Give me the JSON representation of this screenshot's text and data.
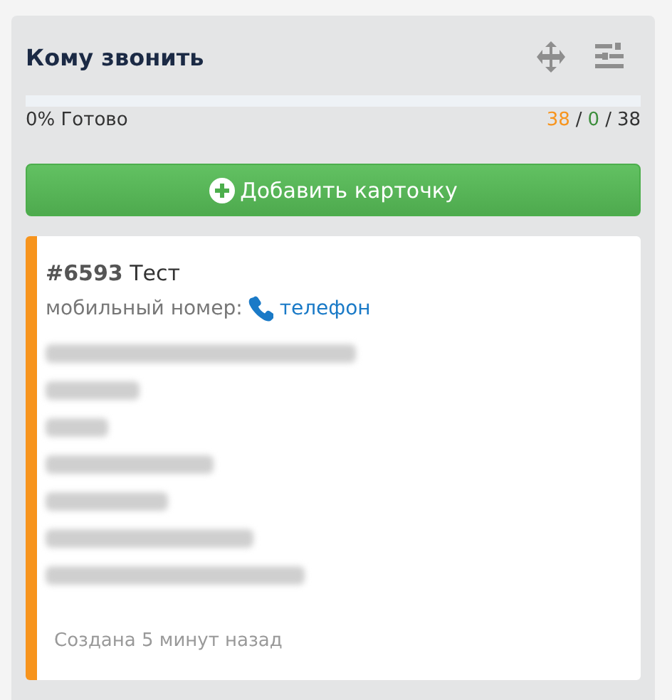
{
  "column": {
    "title": "Кому звонить",
    "progress": {
      "level": 0,
      "label": "0% Готово"
    },
    "counts": [
      {
        "kind": "value",
        "text": "38",
        "color": "#f7941d"
      },
      {
        "kind": "separator",
        "text": "/"
      },
      {
        "kind": "value",
        "text": "0",
        "color": "#3c8d3c"
      },
      {
        "kind": "separator",
        "text": "/"
      },
      {
        "kind": "value",
        "text": "38",
        "color": "#333333"
      }
    ],
    "add_button": "Добавить карточку",
    "cards": [
      {
        "number": "#6593",
        "title": "Тест",
        "color": "#f7941d",
        "phone_label": "мобильный номер:",
        "phone_link": "телефон",
        "redacted_lines": [
          {
            "kind": "redacted"
          },
          {
            "kind": "redacted"
          },
          {
            "kind": "redacted"
          },
          {
            "kind": "redacted"
          },
          {
            "kind": "redacted"
          },
          {
            "kind": "redacted"
          },
          {
            "kind": "redacted"
          }
        ],
        "created": "Создана 5 минут назад"
      }
    ]
  }
}
